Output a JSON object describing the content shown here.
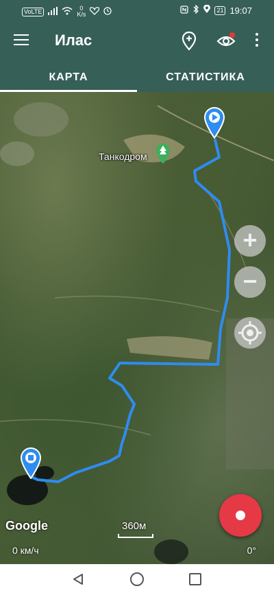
{
  "status_bar": {
    "volte": "VoLTE",
    "network_speed_value": "0",
    "network_speed_unit": "K/s",
    "battery": "21",
    "time": "19:07"
  },
  "app_bar": {
    "title": "Илас"
  },
  "tabs": [
    {
      "label": "КАРТА",
      "active": true
    },
    {
      "label": "СТАТИСТИКА",
      "active": false
    }
  ],
  "map": {
    "poi_label": "Танкодром",
    "google_logo": "Google",
    "scale_label": "360м",
    "speed_text": "0 км/ч",
    "heading_text": "0°",
    "track_color": "#2f8cf0",
    "record_color": "#e53945"
  },
  "colors": {
    "toolbar": "#365f58",
    "accent_red": "#e53935"
  }
}
